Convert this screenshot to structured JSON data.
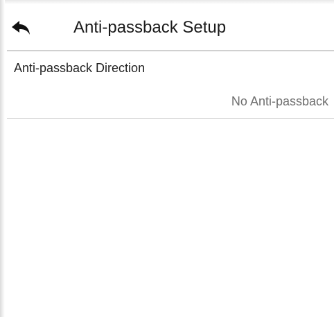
{
  "header": {
    "back_icon": "back-arrow-icon",
    "title": "Anti-passback Setup"
  },
  "settings": [
    {
      "label": "Anti-passback Direction",
      "value": "No Anti-passback"
    }
  ],
  "colors": {
    "background": "#ffffff",
    "divider": "#d0d0d0",
    "title_text": "#1a1a1a",
    "value_text": "#6e6e6e"
  }
}
